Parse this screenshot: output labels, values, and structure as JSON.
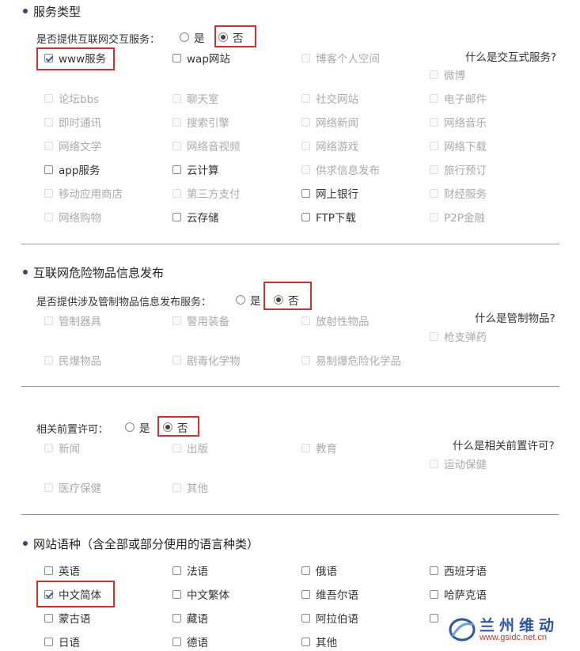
{
  "section1": {
    "title": "服务类型",
    "question": "是否提供互联网交互服务：",
    "yes": "是",
    "no": "否",
    "hint": "什么是交互式服务?",
    "items": [
      {
        "label": "www服务",
        "checked": true,
        "enabled": true
      },
      {
        "label": "wap网站",
        "checked": false,
        "enabled": true
      },
      {
        "label": "博客个人空间",
        "checked": false,
        "enabled": false
      },
      {
        "label": "微博",
        "checked": false,
        "enabled": false
      },
      {
        "label": "论坛bbs",
        "checked": false,
        "enabled": false
      },
      {
        "label": "聊天室",
        "checked": false,
        "enabled": false
      },
      {
        "label": "社交网站",
        "checked": false,
        "enabled": false
      },
      {
        "label": "电子邮件",
        "checked": false,
        "enabled": false
      },
      {
        "label": "即时通讯",
        "checked": false,
        "enabled": false
      },
      {
        "label": "搜索引擎",
        "checked": false,
        "enabled": false
      },
      {
        "label": "网络新闻",
        "checked": false,
        "enabled": false
      },
      {
        "label": "网络音乐",
        "checked": false,
        "enabled": false
      },
      {
        "label": "网络文学",
        "checked": false,
        "enabled": false
      },
      {
        "label": "网络音视频",
        "checked": false,
        "enabled": false
      },
      {
        "label": "网络游戏",
        "checked": false,
        "enabled": false
      },
      {
        "label": "网络下载",
        "checked": false,
        "enabled": false
      },
      {
        "label": "app服务",
        "checked": false,
        "enabled": true
      },
      {
        "label": "云计算",
        "checked": false,
        "enabled": true
      },
      {
        "label": "供求信息发布",
        "checked": false,
        "enabled": false
      },
      {
        "label": "旅行预订",
        "checked": false,
        "enabled": false
      },
      {
        "label": "移动应用商店",
        "checked": false,
        "enabled": false
      },
      {
        "label": "第三方支付",
        "checked": false,
        "enabled": false
      },
      {
        "label": "网上银行",
        "checked": false,
        "enabled": true
      },
      {
        "label": "财经服务",
        "checked": false,
        "enabled": false
      },
      {
        "label": "网络购物",
        "checked": false,
        "enabled": false
      },
      {
        "label": "云存储",
        "checked": false,
        "enabled": true
      },
      {
        "label": "FTP下载",
        "checked": false,
        "enabled": true
      },
      {
        "label": "P2P金融",
        "checked": false,
        "enabled": false
      }
    ]
  },
  "section2": {
    "title": "互联网危险物品信息发布",
    "question": "是否提供涉及管制物品信息发布服务：",
    "yes": "是",
    "no": "否",
    "hint": "什么是管制物品?",
    "items": [
      {
        "label": "管制器具",
        "enabled": false
      },
      {
        "label": "警用装备",
        "enabled": false
      },
      {
        "label": "放射性物品",
        "enabled": false
      },
      {
        "label": "枪支弹药",
        "enabled": false
      },
      {
        "label": "民爆物品",
        "enabled": false
      },
      {
        "label": "剧毒化学物",
        "enabled": false
      },
      {
        "label": "易制爆危险化学品",
        "enabled": false
      }
    ]
  },
  "section3": {
    "question": "相关前置许可：",
    "yes": "是",
    "no": "否",
    "hint": "什么是相关前置许可?",
    "items": [
      {
        "label": "新闻",
        "enabled": false
      },
      {
        "label": "出版",
        "enabled": false
      },
      {
        "label": "教育",
        "enabled": false
      },
      {
        "label": "运动保健",
        "enabled": false
      },
      {
        "label": "医疗保健",
        "enabled": false
      },
      {
        "label": "其他",
        "enabled": false
      }
    ]
  },
  "section4": {
    "title": "网站语种（含全部或部分使用的语言种类）",
    "items": [
      {
        "label": "英语",
        "checked": false
      },
      {
        "label": "法语",
        "checked": false
      },
      {
        "label": "俄语",
        "checked": false
      },
      {
        "label": "西班牙语",
        "checked": false
      },
      {
        "label": "中文简体",
        "checked": true
      },
      {
        "label": "中文繁体",
        "checked": false
      },
      {
        "label": "维吾尔语",
        "checked": false
      },
      {
        "label": "哈萨克语",
        "checked": false
      },
      {
        "label": "蒙古语",
        "checked": false
      },
      {
        "label": "藏语",
        "checked": false
      },
      {
        "label": "阿拉伯语",
        "checked": false
      },
      {
        "label": "",
        "checked": false
      },
      {
        "label": "日语",
        "checked": false
      },
      {
        "label": "德语",
        "checked": false
      },
      {
        "label": "其他",
        "checked": false
      }
    ]
  },
  "watermark": {
    "name": "兰州维动",
    "url": "www.gsidc.net.cn"
  },
  "colors": {
    "highlight": "#d62d2d",
    "bullet": "#2d4a7e",
    "disabled_text": "#aaaaaa"
  }
}
